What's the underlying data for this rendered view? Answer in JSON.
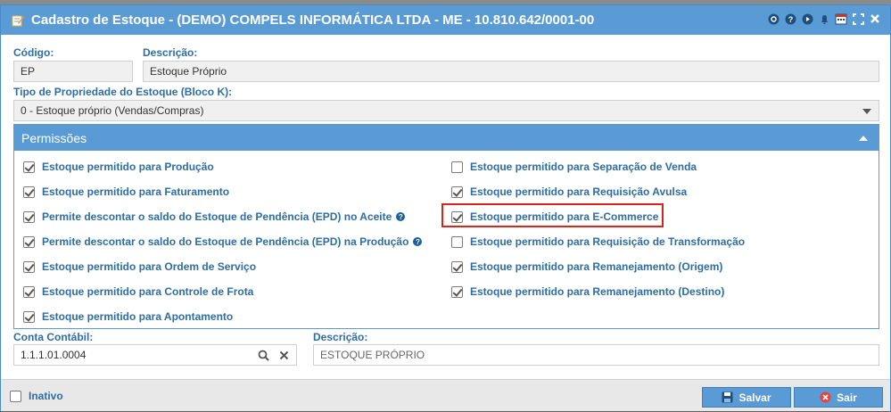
{
  "dialog": {
    "title": "Cadastro de Estoque - (DEMO) COMPELS INFORMÁTICA LTDA - ME - 10.810.642/0001-00",
    "title_icon": "edit-note-icon",
    "actions": [
      "refresh-icon",
      "help-icon",
      "play-icon",
      "bell-icon",
      "calendar-icon",
      "fullscreen-icon",
      "close-icon"
    ]
  },
  "form": {
    "codigo_label": "Código:",
    "codigo_value": "EP",
    "descricao_label": "Descrição:",
    "descricao_value": "Estoque Próprio",
    "tipo_label": "Tipo de Propriedade do Estoque (Bloco K):",
    "tipo_value": "0 - Estoque próprio (Vendas/Compras)",
    "conta_label": "Conta Contábil:",
    "conta_value": "1.1.1.01.0004",
    "conta_desc_label": "Descrição:",
    "conta_desc_value": "ESTOQUE PRÓPRIO"
  },
  "permissoes": {
    "title": "Permissões",
    "left": [
      {
        "label": "Estoque permitido para Produção",
        "checked": true,
        "help": false
      },
      {
        "label": "Estoque permitido para Faturamento",
        "checked": true,
        "help": false
      },
      {
        "label": "Permite descontar o saldo do Estoque de Pendência (EPD) no Aceite",
        "checked": true,
        "help": true
      },
      {
        "label": "Permite descontar o saldo do Estoque de Pendência (EPD) na Produção",
        "checked": true,
        "help": true
      },
      {
        "label": "Estoque permitido para Ordem de Serviço",
        "checked": true,
        "help": false
      },
      {
        "label": "Estoque permitido para Controle de Frota",
        "checked": true,
        "help": false
      },
      {
        "label": "Estoque permitido para Apontamento",
        "checked": true,
        "help": false
      }
    ],
    "right": [
      {
        "label": "Estoque permitido para Separação de Venda",
        "checked": false
      },
      {
        "label": "Estoque permitido para Requisição Avulsa",
        "checked": true
      },
      {
        "label": "Estoque permitido para E-Commerce",
        "checked": true
      },
      {
        "label": "Estoque permitido para Requisição de Transformação",
        "checked": false
      },
      {
        "label": "Estoque permitido para Remanejamento (Origem)",
        "checked": true
      },
      {
        "label": "Estoque permitido para Remanejamento (Destino)",
        "checked": true
      }
    ]
  },
  "footer": {
    "inativo_label": "Inativo",
    "inativo_checked": false,
    "salvar_label": "Salvar",
    "sair_label": "Sair"
  },
  "colors": {
    "accent": "#5b9bd5",
    "label": "#2e6da4",
    "highlight": "#d9231b"
  }
}
